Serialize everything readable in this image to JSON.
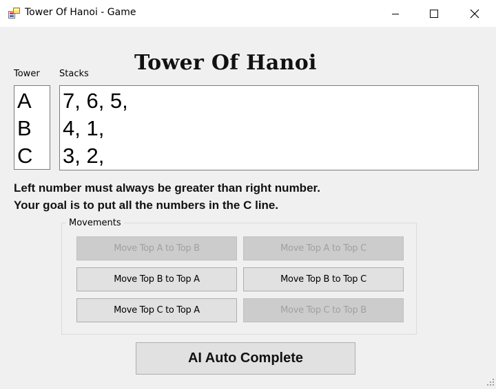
{
  "window": {
    "title": "Tower Of Hanoi - Game"
  },
  "heading": "Tower Of Hanoi",
  "labels": {
    "tower": "Tower",
    "stacks": "Stacks"
  },
  "towers": [
    "A",
    "B",
    "C"
  ],
  "stacks": [
    "7, 6, 5,",
    "4, 1,",
    "3, 2,"
  ],
  "instructions": [
    "Left number must always be greater than right number.",
    "Your goal is to put all the numbers in the C line."
  ],
  "movements": {
    "legend": "Movements",
    "buttons": {
      "a_to_b": {
        "label": "Move Top A to Top B",
        "enabled": false
      },
      "a_to_c": {
        "label": "Move Top A to Top C",
        "enabled": false
      },
      "b_to_a": {
        "label": "Move Top B to Top A",
        "enabled": true
      },
      "b_to_c": {
        "label": "Move Top B to Top C",
        "enabled": true
      },
      "c_to_a": {
        "label": "Move Top C to Top A",
        "enabled": true
      },
      "c_to_b": {
        "label": "Move Top C to Top B",
        "enabled": false
      }
    }
  },
  "ai_button": "AI Auto Complete",
  "icons": {
    "app": "app-icon",
    "minimize": "minimize-icon",
    "maximize": "maximize-icon",
    "close": "close-icon",
    "resize": "resize-grip-icon"
  }
}
